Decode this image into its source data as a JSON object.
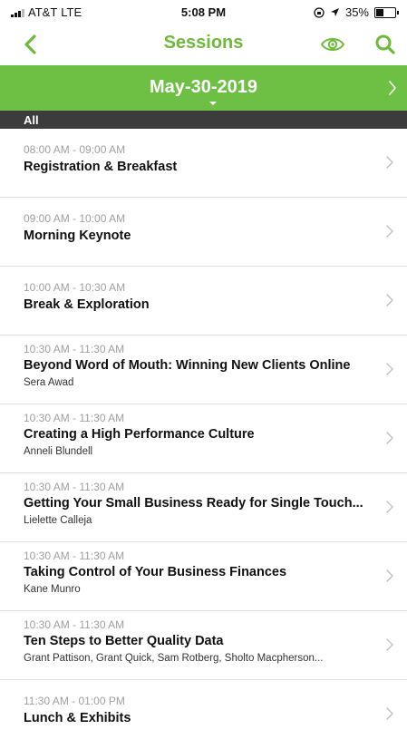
{
  "status_bar": {
    "carrier": "AT&T",
    "network": "LTE",
    "time": "5:08 PM",
    "battery_percent": "35%",
    "battery_level": 0.35,
    "icons": [
      "signal-icon",
      "location-icon",
      "orientation-lock-icon",
      "battery-icon"
    ]
  },
  "nav": {
    "title": "Sessions",
    "back_icon": "chevron-left-icon",
    "eye_icon": "eye-icon",
    "search_icon": "search-icon"
  },
  "date_selector": {
    "date": "May-30-2019",
    "next_icon": "chevron-right-icon",
    "caret_icon": "caret-down-icon"
  },
  "filter": {
    "label": "All"
  },
  "colors": {
    "accent": "#6dc043",
    "title_green": "#6dbb3b",
    "filter_bg": "#3c3c3c",
    "time_gray": "#a0a0a0"
  },
  "sessions": [
    {
      "time": "08:00 AM - 09:00 AM",
      "title": "Registration & Breakfast",
      "speakers": ""
    },
    {
      "time": "09:00 AM - 10:00 AM",
      "title": "Morning Keynote",
      "speakers": ""
    },
    {
      "time": "10:00 AM - 10:30 AM",
      "title": "Break & Exploration",
      "speakers": ""
    },
    {
      "time": "10:30 AM - 11:30 AM",
      "title": "Beyond Word of Mouth: Winning New Clients Online",
      "speakers": "Sera Awad"
    },
    {
      "time": "10:30 AM - 11:30 AM",
      "title": "Creating a High Performance Culture",
      "speakers": "Anneli Blundell"
    },
    {
      "time": "10:30 AM - 11:30 AM",
      "title": "Getting Your Small Business Ready for Single Touch...",
      "speakers": "Lielette Calleja"
    },
    {
      "time": "10:30 AM - 11:30 AM",
      "title": "Taking Control of Your Business Finances",
      "speakers": "Kane Munro"
    },
    {
      "time": "10:30 AM - 11:30 AM",
      "title": "Ten Steps to Better Quality Data",
      "speakers": "Grant Pattison, Grant Quick, Sam Rotberg, Sholto Macpherson..."
    },
    {
      "time": "11:30 AM - 01:00 PM",
      "title": "Lunch & Exhibits",
      "speakers": ""
    }
  ]
}
